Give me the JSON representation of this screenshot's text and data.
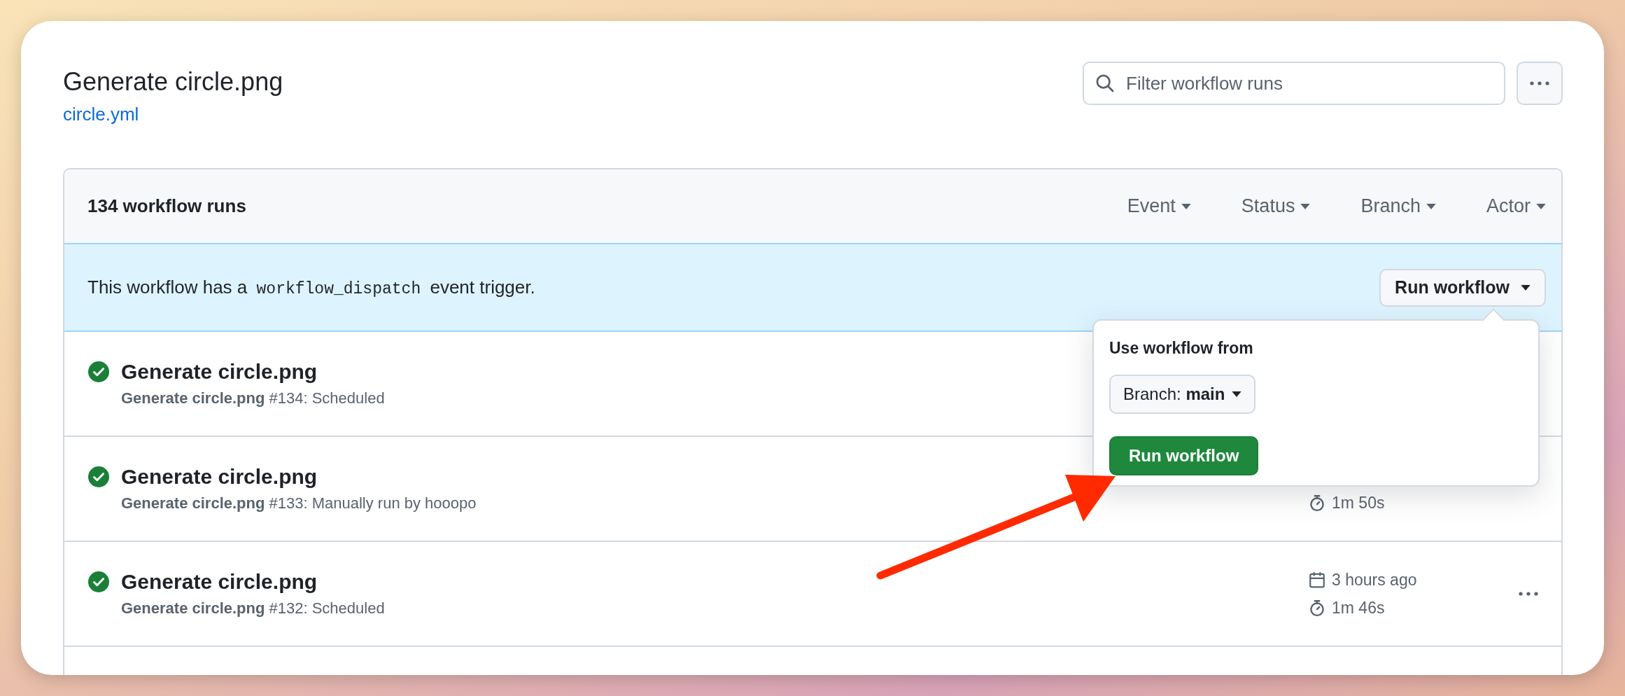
{
  "header": {
    "title": "Generate circle.png",
    "file_link": "circle.yml",
    "search": {
      "placeholder": "Filter workflow runs"
    }
  },
  "runs": {
    "count": "134 workflow runs",
    "filters": [
      "Event",
      "Status",
      "Branch",
      "Actor"
    ]
  },
  "banner": {
    "before": "This workflow has a",
    "code": "workflow_dispatch",
    "after": "event trigger.",
    "button": "Run workflow"
  },
  "popover": {
    "heading": "Use workflow from",
    "branch_label": "Branch:",
    "branch": "main",
    "button": "Run workflow"
  },
  "rows": [
    {
      "title": "Generate circle.png",
      "subtitle": "**Generate circle.png** #134: Scheduled",
      "more_button": false
    },
    {
      "title": "Generate circle.png",
      "subtitle": "**Generate circle.png** #133: Manually run by hooopo",
      "duration": "1m 50s",
      "more_button": false
    },
    {
      "title": "Generate circle.png",
      "subtitle": "**Generate circle.png** #132: Scheduled",
      "date": "3 hours ago",
      "duration": "1m 46s",
      "more_button": true
    }
  ]
}
